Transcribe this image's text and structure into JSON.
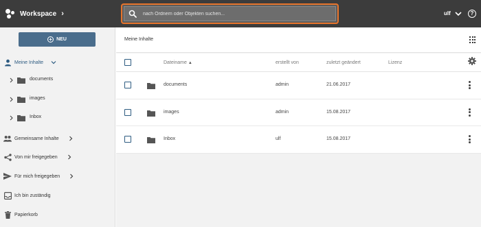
{
  "header": {
    "app_title": "Workspace",
    "search_placeholder": "nach Ordnern oder Objekten suchen...",
    "user_name": "ulf",
    "help_label": "?"
  },
  "sidebar": {
    "new_button_label": "NEU",
    "my_content_label": "Meine Inhalte",
    "tree": [
      {
        "label": "documents"
      },
      {
        "label": "images"
      },
      {
        "label": "Inbox"
      }
    ],
    "items": [
      {
        "label": "Gemeinsame Inhalte"
      },
      {
        "label": "Von mir freigegeben"
      },
      {
        "label": "Für mich freigegeben"
      },
      {
        "label": "Ich bin zuständig"
      },
      {
        "label": "Papierkorb"
      }
    ]
  },
  "main": {
    "breadcrumb": "Meine Inhalte",
    "columns": {
      "filename": "Dateiname",
      "created_by": "erstellt von",
      "modified": "zuletzt geändert",
      "license": "Lizenz"
    },
    "rows": [
      {
        "name": "documents",
        "created_by": "admin",
        "modified": "21.06.2017",
        "license": ""
      },
      {
        "name": "images",
        "created_by": "admin",
        "modified": "15.08.2017",
        "license": ""
      },
      {
        "name": "Inbox",
        "created_by": "ulf",
        "modified": "15.08.2017",
        "license": ""
      }
    ]
  },
  "colors": {
    "topbar": "#3c3c3c",
    "search_highlight": "#e8742b",
    "accent": "#4a6d8c",
    "link": "#2c5a80"
  }
}
